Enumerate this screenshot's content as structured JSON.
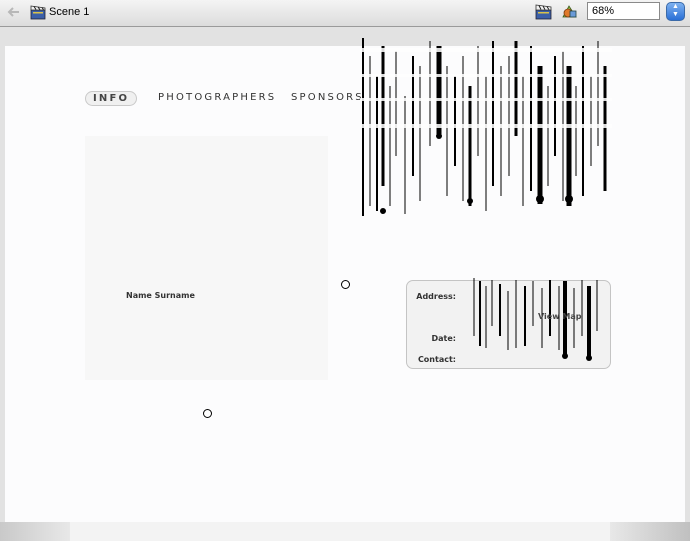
{
  "toolbar": {
    "scene_label": "Scene 1",
    "zoom_value": "68%",
    "icons": [
      "back-arrow-icon",
      "scene-clapper-icon",
      "edit-scene-icon",
      "edit-symbol-icon",
      "zoom-stepper-icon"
    ]
  },
  "nav": {
    "items": [
      {
        "label": "INFO",
        "selected": true
      },
      {
        "label": "PHOTOGRAPHERS",
        "selected": false
      },
      {
        "label": "SPONSORS",
        "selected": false
      }
    ]
  },
  "photo_panel": {
    "name": "Name Surname"
  },
  "info_card": {
    "address_label": "Address:",
    "date_label": "Date:",
    "contact_label": "Contact:",
    "view_map": "View Map"
  },
  "colors": {
    "stage": "#fcfcfd",
    "pasteboard": "#e2e2e2",
    "toolbar": "#e6e6e6",
    "stepper_blue": "#2a6fd6"
  }
}
